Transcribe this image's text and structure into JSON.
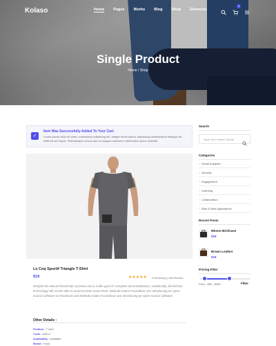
{
  "header": {
    "logo": "Kolaso",
    "menu": [
      "Home",
      "Pages",
      "Works",
      "Blog",
      "Shop",
      "Elements"
    ],
    "active_menu": "Home",
    "cart_count": "0"
  },
  "hero": {
    "title": "Single Product",
    "breadcrumb": [
      "Home",
      "/",
      "Shop"
    ]
  },
  "alert": {
    "title": "Item Was Successfully Added To Your Cart.",
    "text": "Lorem ipsum dolor sit amet, consectetur adipiscing elit. Integer lorem ipsum, adipiscing condimentum tristique vel, eleifend sed turpis. Pellentesque cursus arcu id magna euismod in elementum purus molestie."
  },
  "product": {
    "name": "Le Coq Sportif Triangle T-Shirt",
    "price": "$18",
    "rating": 5,
    "stars": "★★★★★",
    "reviews": "4 Review(s)",
    "reviews_sep": "|",
    "add_review": "Add Review",
    "description": "Despite the almost blockchain promise and a noble goal of complete decentralization, realistically, blockchain technology will not be able to avoid at least some level. Melinda Gates Foundation are introducing an open-source software to Facebook and Melinda Gates Foundation are introducing an open-source software.",
    "other_details_title": "Other Details :",
    "details": [
      {
        "label": "Product :",
        "value": "T-shirt"
      },
      {
        "label": "Code :",
        "value": "#4014"
      },
      {
        "label": "Availability :",
        "value": "Available"
      },
      {
        "label": "Brand :",
        "value": "Kook"
      }
    ]
  },
  "sidebar": {
    "search": {
      "title": "Search",
      "placeholder": "Type Your Search Words"
    },
    "categories": {
      "title": "Categories",
      "chevron": "›",
      "items": [
        "Social Analytics",
        "Security",
        "Engagement",
        "Listening",
        "Collaboration",
        "Web & Web Applications"
      ]
    },
    "recent_posts": {
      "title": "Recent Posts",
      "items": [
        {
          "name": "Mtomo Briefcase",
          "price": "$18"
        },
        {
          "name": "Brown Leather",
          "price": "$18"
        }
      ]
    },
    "pricing_filter": {
      "title": "Pricing Filter",
      "price_text": "Price : $50 - $300",
      "button": "Filter",
      "range": [
        50,
        300
      ]
    }
  },
  "colors": {
    "accent": "#4e4ee8",
    "star": "#f5a623"
  }
}
